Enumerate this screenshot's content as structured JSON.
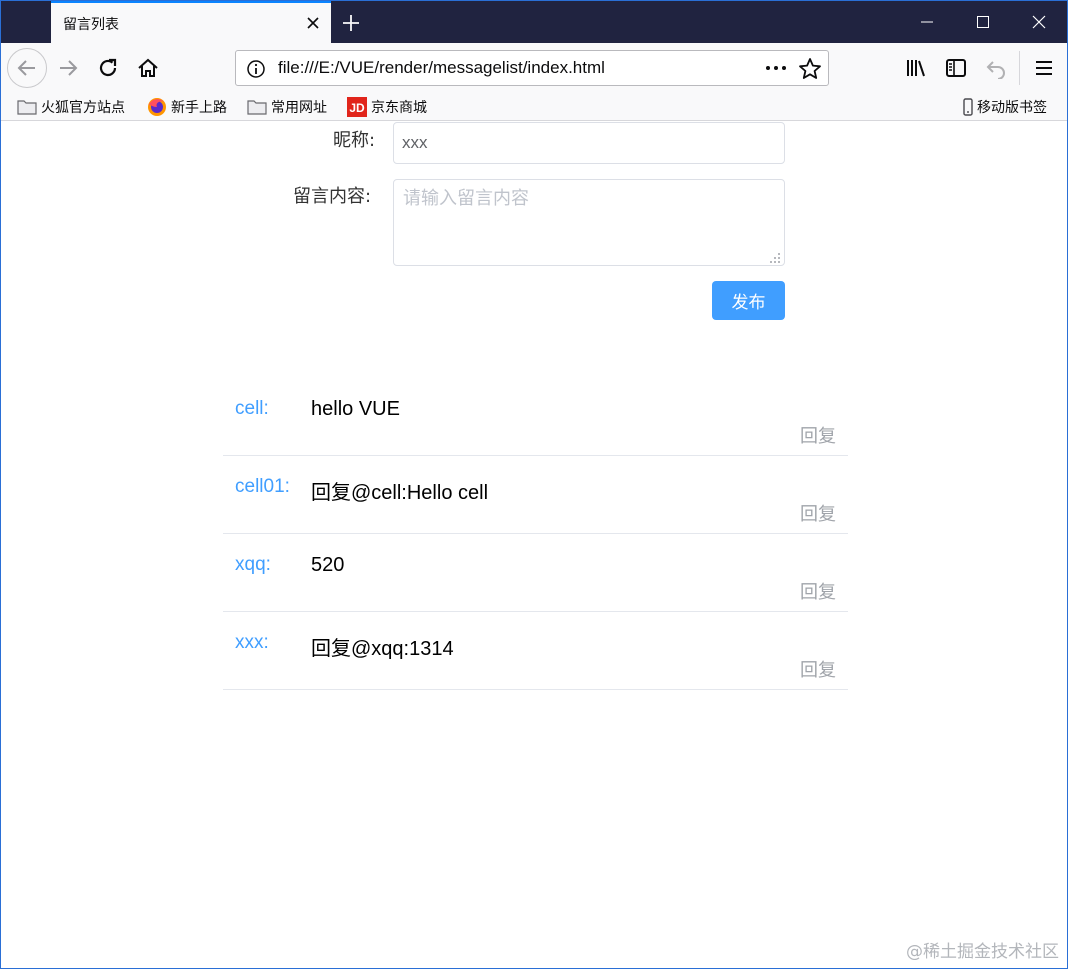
{
  "browser": {
    "tab_title": "留言列表",
    "url": "file:///E:/VUE/render/messagelist/index.html",
    "bookmarks": [
      {
        "label": "火狐官方站点",
        "icon": "folder-icon"
      },
      {
        "label": "新手上路",
        "icon": "firefox-icon"
      },
      {
        "label": "常用网址",
        "icon": "folder-icon"
      },
      {
        "label": "京东商城",
        "icon": "jd-icon"
      }
    ],
    "mobile_bookmarks": "移动版书签"
  },
  "form": {
    "nickname_label": "昵称:",
    "nickname_value": "xxx",
    "content_label": "留言内容:",
    "content_placeholder": "请输入留言内容",
    "publish_label": "发布"
  },
  "messages": [
    {
      "user": "cell:",
      "text": "hello VUE",
      "reply": "回复"
    },
    {
      "user": "cell01:",
      "text": "回复@cell:Hello cell",
      "reply": "回复"
    },
    {
      "user": "xqq:",
      "text": "520",
      "reply": "回复"
    },
    {
      "user": "xxx:",
      "text": "回复@xqq:1314",
      "reply": "回复"
    }
  ],
  "watermark": "@稀土掘金技术社区",
  "colors": {
    "accent": "#409eff",
    "titlebar": "#202340",
    "tab_highlight": "#0a84ff",
    "jd_red": "#e1251b"
  }
}
